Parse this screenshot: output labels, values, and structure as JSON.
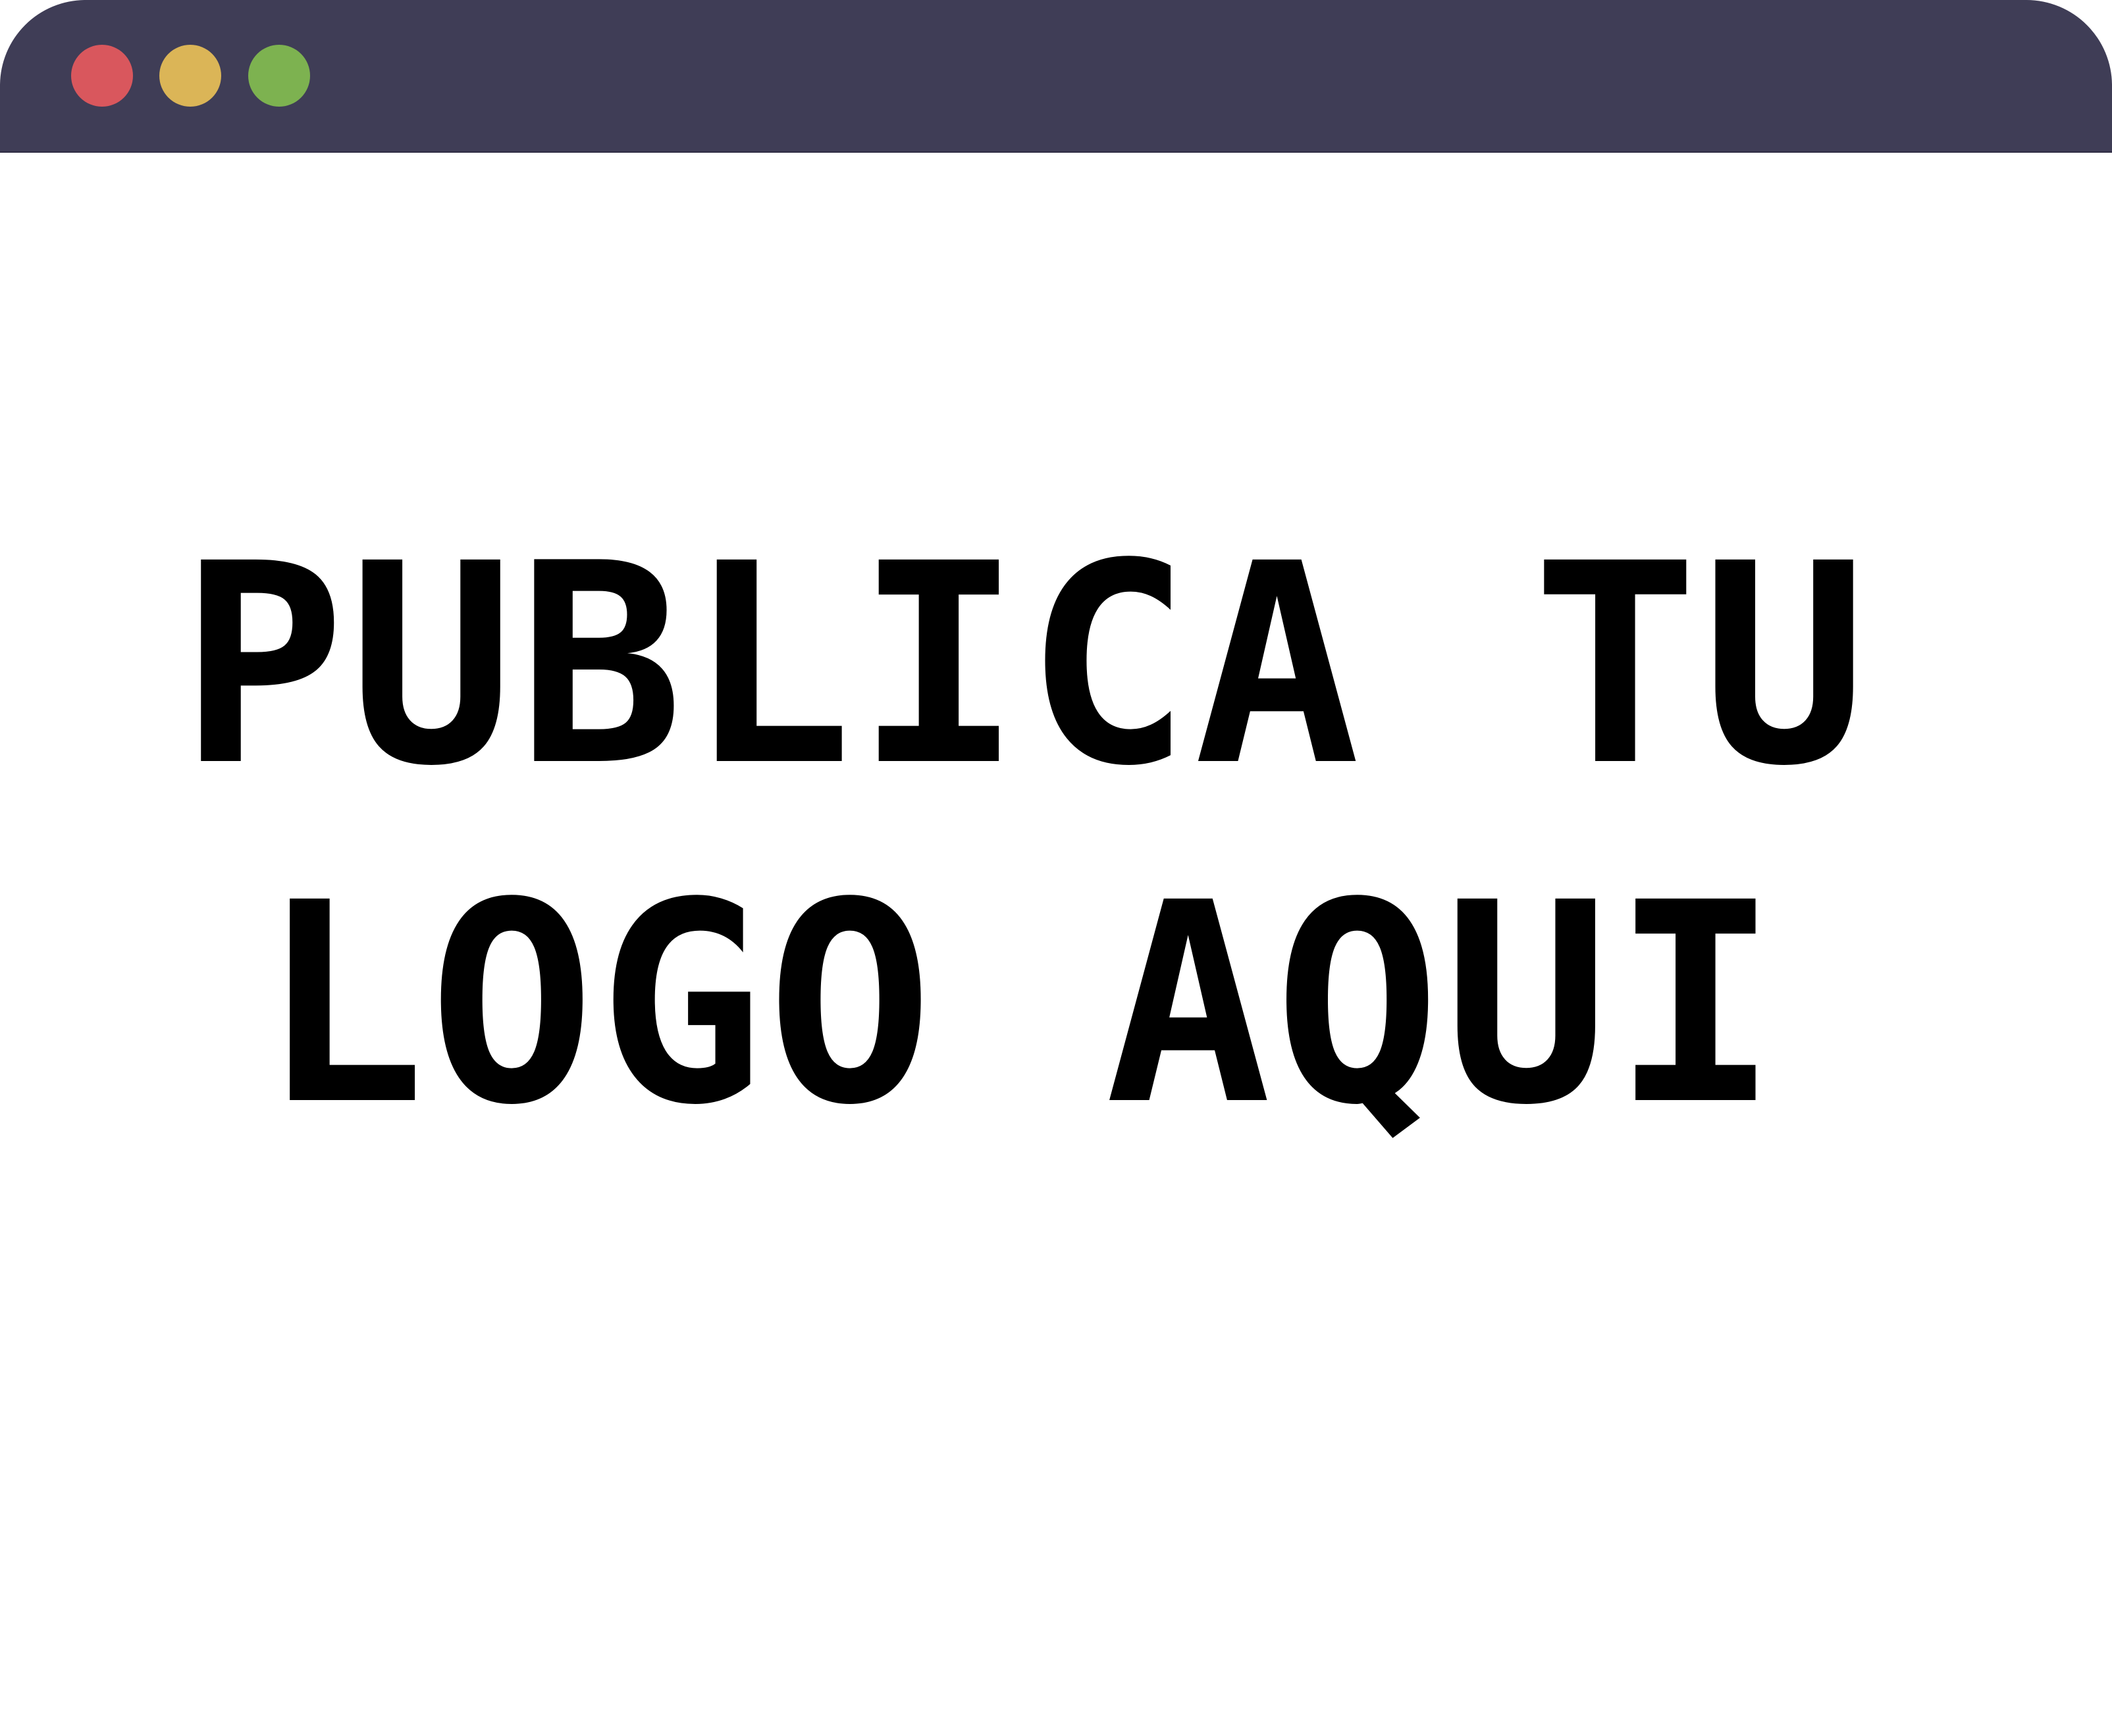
{
  "window": {
    "traffic_lights": {
      "close_color": "#d9575d",
      "minimize_color": "#dbb557",
      "maximize_color": "#7db250"
    },
    "titlebar_color": "#3f3d56"
  },
  "logo": {
    "line1": "PUBLICA TU",
    "line2": "LOGO AQUI",
    "text_color": "#000000"
  }
}
